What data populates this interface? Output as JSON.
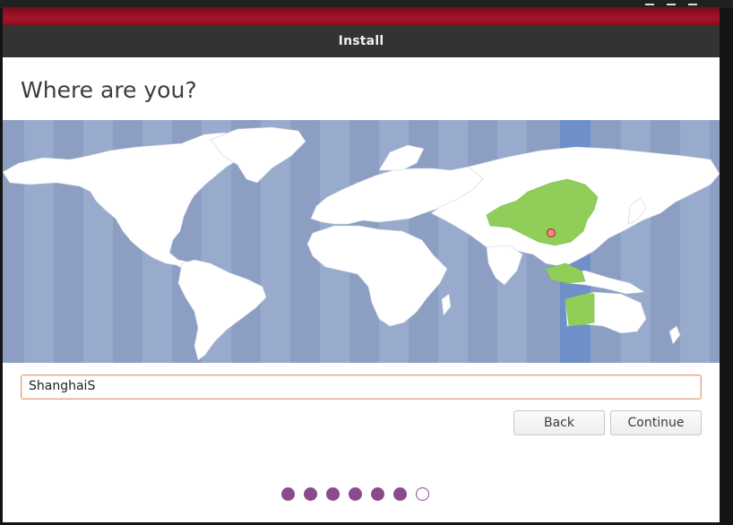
{
  "window": {
    "title": "Install"
  },
  "page": {
    "heading": "Where are you?"
  },
  "location": {
    "value": "ShanghaiS",
    "selected_timezone_offset_hours": 8
  },
  "buttons": {
    "back": "Back",
    "continue": "Continue"
  },
  "progress": {
    "total_steps": 7,
    "completed_steps": 6
  },
  "colors": {
    "accent": "#a5132a",
    "titlebar": "#333333",
    "ocean": "#8c9fc3",
    "land": "#ffffff",
    "selected_zone_land": "#8fcf59",
    "selected_zone_band": "#6f8fc8",
    "progress_dot": "#8b4a8c",
    "input_focus": "#e8a17f"
  },
  "icons": {
    "location_pin": "map-pin-icon"
  }
}
